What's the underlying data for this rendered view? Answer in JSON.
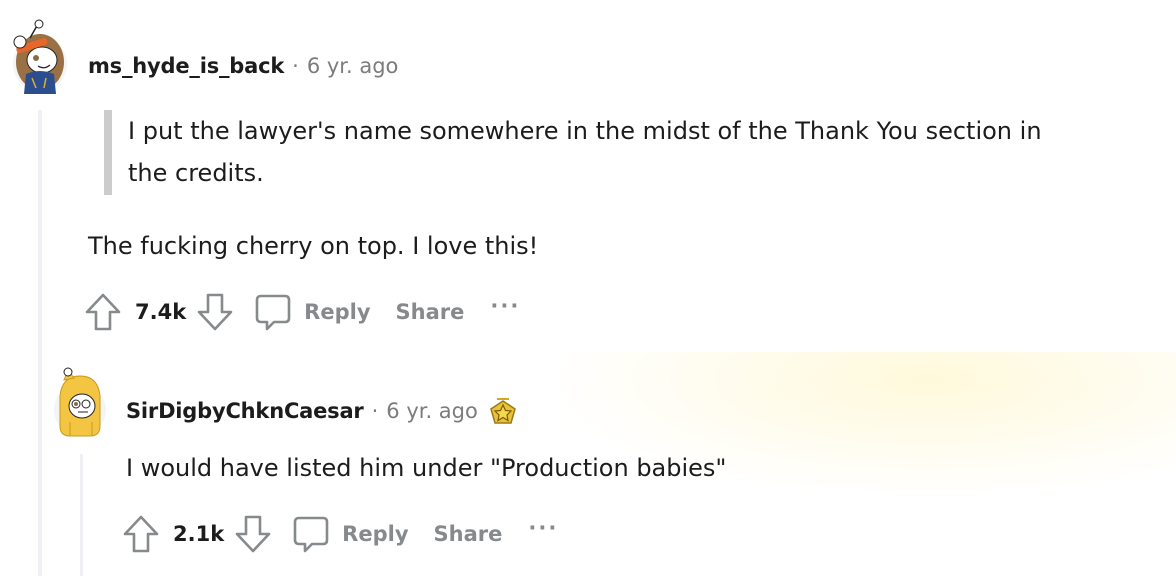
{
  "comments": [
    {
      "username": "ms_hyde_is_back",
      "separator": "·",
      "time": "6 yr. ago",
      "quote": "I put the lawyer's name somewhere in the midst of the Thank You section in the credits.",
      "quote_line1": "I put the lawyer's name somewhere in the midst of the Thank You section in",
      "quote_line2": "the credits.",
      "body": "The fucking cherry on top. I love this!",
      "score": "7.4k",
      "reply_label": "Reply",
      "share_label": "Share",
      "more_label": "···"
    },
    {
      "username": "SirDigbyChknCaesar",
      "separator": "·",
      "time": "6 yr. ago",
      "badge": "star-award",
      "body": "I would have listed him under \"Production babies\"",
      "score": "2.1k",
      "reply_label": "Reply",
      "share_label": "Share",
      "more_label": "···"
    }
  ]
}
